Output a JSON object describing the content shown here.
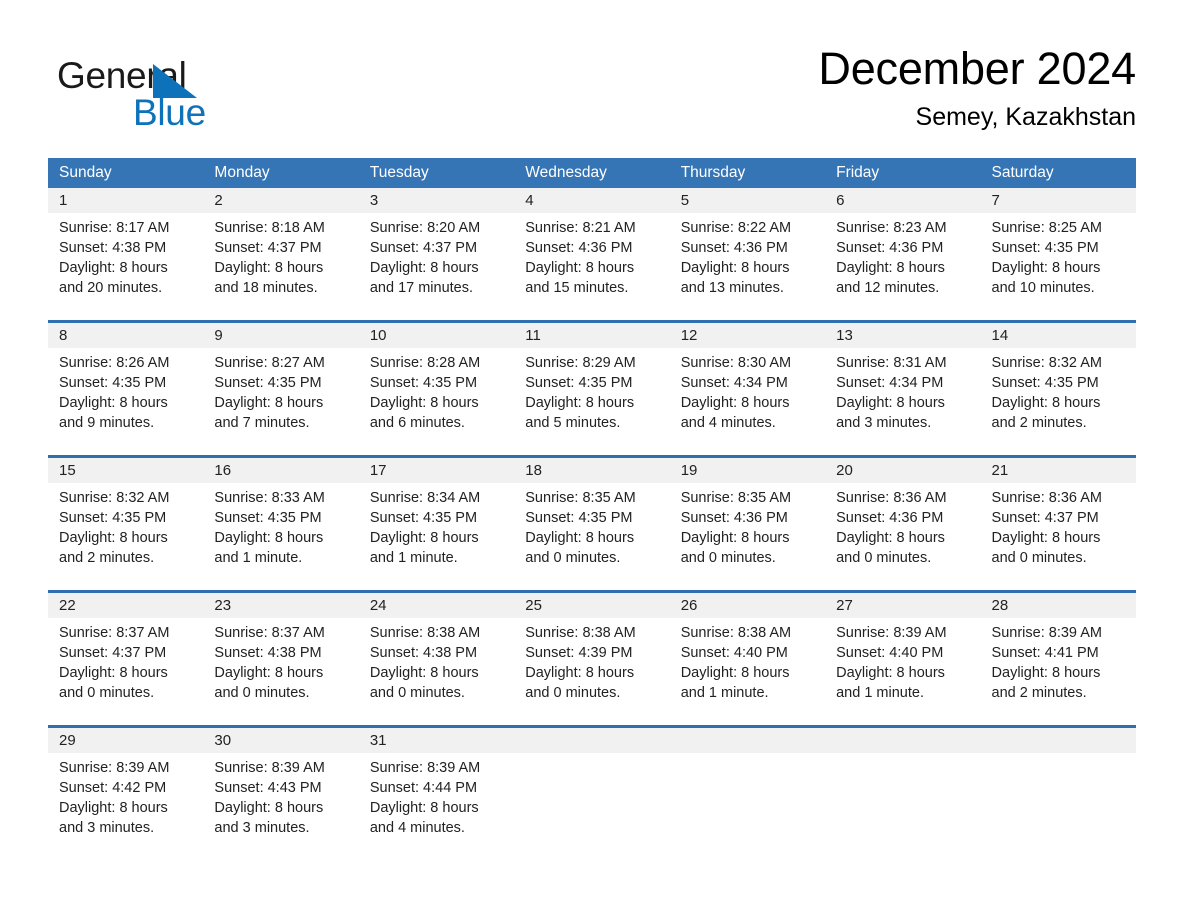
{
  "logo": {
    "word1": "General",
    "word2": "Blue",
    "triangle_color": "#0d72b9",
    "text_color": "#1a1a1a"
  },
  "header": {
    "title": "December 2024",
    "location": "Semey, Kazakhstan"
  },
  "theme": {
    "header_blue": "#3575b5",
    "separator_blue": "#2f6fad",
    "day_band_gray": "#f1f1f1",
    "text": "#222222"
  },
  "weekdays": [
    "Sunday",
    "Monday",
    "Tuesday",
    "Wednesday",
    "Thursday",
    "Friday",
    "Saturday"
  ],
  "weeks": [
    [
      {
        "day": "1",
        "sunrise": "Sunrise: 8:17 AM",
        "sunset": "Sunset: 4:38 PM",
        "daylight1": "Daylight: 8 hours",
        "daylight2": "and 20 minutes."
      },
      {
        "day": "2",
        "sunrise": "Sunrise: 8:18 AM",
        "sunset": "Sunset: 4:37 PM",
        "daylight1": "Daylight: 8 hours",
        "daylight2": "and 18 minutes."
      },
      {
        "day": "3",
        "sunrise": "Sunrise: 8:20 AM",
        "sunset": "Sunset: 4:37 PM",
        "daylight1": "Daylight: 8 hours",
        "daylight2": "and 17 minutes."
      },
      {
        "day": "4",
        "sunrise": "Sunrise: 8:21 AM",
        "sunset": "Sunset: 4:36 PM",
        "daylight1": "Daylight: 8 hours",
        "daylight2": "and 15 minutes."
      },
      {
        "day": "5",
        "sunrise": "Sunrise: 8:22 AM",
        "sunset": "Sunset: 4:36 PM",
        "daylight1": "Daylight: 8 hours",
        "daylight2": "and 13 minutes."
      },
      {
        "day": "6",
        "sunrise": "Sunrise: 8:23 AM",
        "sunset": "Sunset: 4:36 PM",
        "daylight1": "Daylight: 8 hours",
        "daylight2": "and 12 minutes."
      },
      {
        "day": "7",
        "sunrise": "Sunrise: 8:25 AM",
        "sunset": "Sunset: 4:35 PM",
        "daylight1": "Daylight: 8 hours",
        "daylight2": "and 10 minutes."
      }
    ],
    [
      {
        "day": "8",
        "sunrise": "Sunrise: 8:26 AM",
        "sunset": "Sunset: 4:35 PM",
        "daylight1": "Daylight: 8 hours",
        "daylight2": "and 9 minutes."
      },
      {
        "day": "9",
        "sunrise": "Sunrise: 8:27 AM",
        "sunset": "Sunset: 4:35 PM",
        "daylight1": "Daylight: 8 hours",
        "daylight2": "and 7 minutes."
      },
      {
        "day": "10",
        "sunrise": "Sunrise: 8:28 AM",
        "sunset": "Sunset: 4:35 PM",
        "daylight1": "Daylight: 8 hours",
        "daylight2": "and 6 minutes."
      },
      {
        "day": "11",
        "sunrise": "Sunrise: 8:29 AM",
        "sunset": "Sunset: 4:35 PM",
        "daylight1": "Daylight: 8 hours",
        "daylight2": "and 5 minutes."
      },
      {
        "day": "12",
        "sunrise": "Sunrise: 8:30 AM",
        "sunset": "Sunset: 4:34 PM",
        "daylight1": "Daylight: 8 hours",
        "daylight2": "and 4 minutes."
      },
      {
        "day": "13",
        "sunrise": "Sunrise: 8:31 AM",
        "sunset": "Sunset: 4:34 PM",
        "daylight1": "Daylight: 8 hours",
        "daylight2": "and 3 minutes."
      },
      {
        "day": "14",
        "sunrise": "Sunrise: 8:32 AM",
        "sunset": "Sunset: 4:35 PM",
        "daylight1": "Daylight: 8 hours",
        "daylight2": "and 2 minutes."
      }
    ],
    [
      {
        "day": "15",
        "sunrise": "Sunrise: 8:32 AM",
        "sunset": "Sunset: 4:35 PM",
        "daylight1": "Daylight: 8 hours",
        "daylight2": "and 2 minutes."
      },
      {
        "day": "16",
        "sunrise": "Sunrise: 8:33 AM",
        "sunset": "Sunset: 4:35 PM",
        "daylight1": "Daylight: 8 hours",
        "daylight2": "and 1 minute."
      },
      {
        "day": "17",
        "sunrise": "Sunrise: 8:34 AM",
        "sunset": "Sunset: 4:35 PM",
        "daylight1": "Daylight: 8 hours",
        "daylight2": "and 1 minute."
      },
      {
        "day": "18",
        "sunrise": "Sunrise: 8:35 AM",
        "sunset": "Sunset: 4:35 PM",
        "daylight1": "Daylight: 8 hours",
        "daylight2": "and 0 minutes."
      },
      {
        "day": "19",
        "sunrise": "Sunrise: 8:35 AM",
        "sunset": "Sunset: 4:36 PM",
        "daylight1": "Daylight: 8 hours",
        "daylight2": "and 0 minutes."
      },
      {
        "day": "20",
        "sunrise": "Sunrise: 8:36 AM",
        "sunset": "Sunset: 4:36 PM",
        "daylight1": "Daylight: 8 hours",
        "daylight2": "and 0 minutes."
      },
      {
        "day": "21",
        "sunrise": "Sunrise: 8:36 AM",
        "sunset": "Sunset: 4:37 PM",
        "daylight1": "Daylight: 8 hours",
        "daylight2": "and 0 minutes."
      }
    ],
    [
      {
        "day": "22",
        "sunrise": "Sunrise: 8:37 AM",
        "sunset": "Sunset: 4:37 PM",
        "daylight1": "Daylight: 8 hours",
        "daylight2": "and 0 minutes."
      },
      {
        "day": "23",
        "sunrise": "Sunrise: 8:37 AM",
        "sunset": "Sunset: 4:38 PM",
        "daylight1": "Daylight: 8 hours",
        "daylight2": "and 0 minutes."
      },
      {
        "day": "24",
        "sunrise": "Sunrise: 8:38 AM",
        "sunset": "Sunset: 4:38 PM",
        "daylight1": "Daylight: 8 hours",
        "daylight2": "and 0 minutes."
      },
      {
        "day": "25",
        "sunrise": "Sunrise: 8:38 AM",
        "sunset": "Sunset: 4:39 PM",
        "daylight1": "Daylight: 8 hours",
        "daylight2": "and 0 minutes."
      },
      {
        "day": "26",
        "sunrise": "Sunrise: 8:38 AM",
        "sunset": "Sunset: 4:40 PM",
        "daylight1": "Daylight: 8 hours",
        "daylight2": "and 1 minute."
      },
      {
        "day": "27",
        "sunrise": "Sunrise: 8:39 AM",
        "sunset": "Sunset: 4:40 PM",
        "daylight1": "Daylight: 8 hours",
        "daylight2": "and 1 minute."
      },
      {
        "day": "28",
        "sunrise": "Sunrise: 8:39 AM",
        "sunset": "Sunset: 4:41 PM",
        "daylight1": "Daylight: 8 hours",
        "daylight2": "and 2 minutes."
      }
    ],
    [
      {
        "day": "29",
        "sunrise": "Sunrise: 8:39 AM",
        "sunset": "Sunset: 4:42 PM",
        "daylight1": "Daylight: 8 hours",
        "daylight2": "and 3 minutes."
      },
      {
        "day": "30",
        "sunrise": "Sunrise: 8:39 AM",
        "sunset": "Sunset: 4:43 PM",
        "daylight1": "Daylight: 8 hours",
        "daylight2": "and 3 minutes."
      },
      {
        "day": "31",
        "sunrise": "Sunrise: 8:39 AM",
        "sunset": "Sunset: 4:44 PM",
        "daylight1": "Daylight: 8 hours",
        "daylight2": "and 4 minutes."
      },
      {
        "day": "",
        "sunrise": "",
        "sunset": "",
        "daylight1": "",
        "daylight2": ""
      },
      {
        "day": "",
        "sunrise": "",
        "sunset": "",
        "daylight1": "",
        "daylight2": ""
      },
      {
        "day": "",
        "sunrise": "",
        "sunset": "",
        "daylight1": "",
        "daylight2": ""
      },
      {
        "day": "",
        "sunrise": "",
        "sunset": "",
        "daylight1": "",
        "daylight2": ""
      }
    ]
  ]
}
